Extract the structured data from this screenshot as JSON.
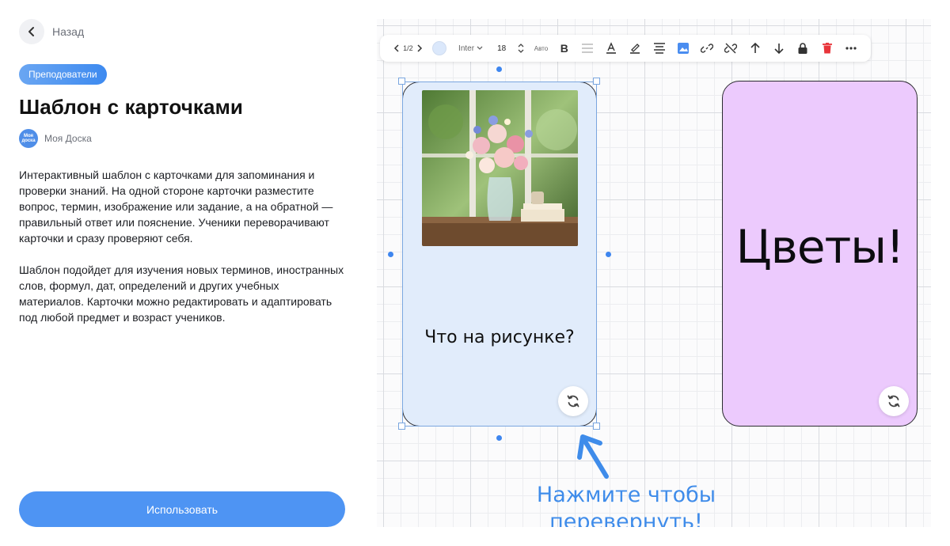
{
  "back": {
    "label": "Назад"
  },
  "category_tag": "Преподователи",
  "title": "Шаблон с карточками",
  "author": {
    "name": "Моя Доска",
    "avatar_text": "Моя доска"
  },
  "description": [
    "Интерактивный шаблон с карточками для запоминания и проверки знаний. На одной стороне карточки разместите вопрос, термин, изображение или задание, а на обратной — правильный ответ или пояснение. Ученики переворачивают карточки и сразу проверяют себя.",
    "Шаблон подойдет для изучения новых терминов, иностранных слов, формул, дат, определений и других учебных материалов. Карточки можно редактировать и адаптировать под любой предмет и возраст учеников."
  ],
  "use_button": "Использовать",
  "toolbar": {
    "pages": "1/2",
    "font": "Inter",
    "font_size": "18",
    "auto": "Авто",
    "bold": "B",
    "swatch_color": "#dbe8fb",
    "icons": [
      "chevron-left-icon",
      "chevron-right-icon",
      "list-icon",
      "text-color-icon",
      "highlighter-icon",
      "align-center-icon",
      "image-icon",
      "link-icon",
      "unlink-icon",
      "arrow-up-icon",
      "arrow-down-icon",
      "lock-icon",
      "trash-icon",
      "more-icon"
    ]
  },
  "cards": {
    "front": {
      "question": "Что на рисунке?",
      "background": "#e1ecfb"
    },
    "back": {
      "answer": "Цветы!",
      "background": "#eccafd"
    }
  },
  "hint": {
    "line1": "Нажмите чтобы",
    "line2": "перевернуть!"
  },
  "colors": {
    "accent": "#4e94f3",
    "hint": "#3f8cea"
  }
}
